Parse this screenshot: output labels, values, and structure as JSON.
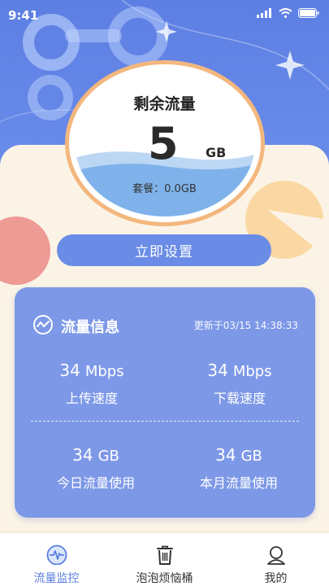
{
  "status_bar": {
    "time": "9:41"
  },
  "gauge": {
    "title": "剩余流量",
    "value": "5",
    "unit": "GB",
    "plan": "套餐：0.0GB"
  },
  "actions": {
    "setup_label": "立即设置"
  },
  "info": {
    "title": "流量信息",
    "updated": "更新于03/15 14:38:33",
    "upload": {
      "value": "34",
      "unit": "Mbps",
      "label": "上传速度"
    },
    "download": {
      "value": "34",
      "unit": "Mbps",
      "label": "下载速度"
    },
    "today": {
      "value": "34",
      "unit": "GB",
      "label": "今日流量使用"
    },
    "month": {
      "value": "34",
      "unit": "GB",
      "label": "本月流量使用"
    }
  },
  "tabs": [
    {
      "label": "流量监控",
      "icon": "traffic-monitor-icon",
      "active": true
    },
    {
      "label": "泡泡烦恼桶",
      "icon": "trash-bin-icon",
      "active": false
    },
    {
      "label": "我的",
      "icon": "profile-icon",
      "active": false
    }
  ],
  "colors": {
    "accent": "#6a8ce6",
    "header": "#5d7fe3",
    "card": "#7d98e7",
    "ring": "#f3b77e",
    "background": "#fbf4e6"
  }
}
